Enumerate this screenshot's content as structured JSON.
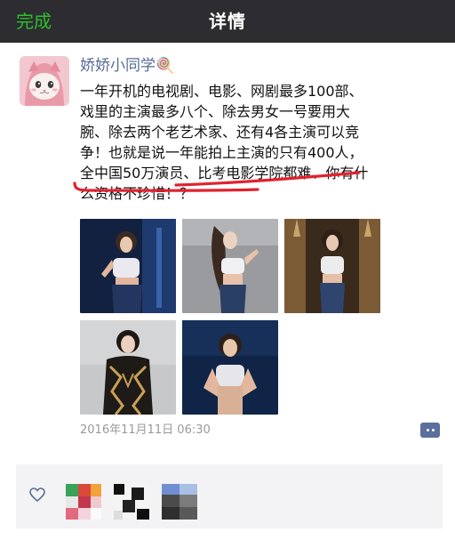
{
  "header": {
    "done_label": "完成",
    "title": "详情"
  },
  "post": {
    "author": "娇娇小同学🍭",
    "text": "一年开机的电视剧、电影、网剧最多100部、\n戏里的主演最多八个、除去男女一号要用大\n腕、除去两个老艺术家、还有4各主演可以竞\n争！也就是说一年能拍上主演的只有400人，\n全中国50万演员、比考电影学院都难、你有什\n么资格不珍惜！？",
    "timestamp": "2016年11月11日  06:30",
    "photo_count": 5,
    "like_count": 3
  },
  "colors": {
    "topbar": "#2d2d31",
    "done_green": "#2bbf2b",
    "author_blue": "#576b95",
    "annotation_red": "#e0222e",
    "likes_bg": "#f3f3f5"
  },
  "icons": {
    "more": "comment-more-icon",
    "like": "heart-outline-icon"
  }
}
